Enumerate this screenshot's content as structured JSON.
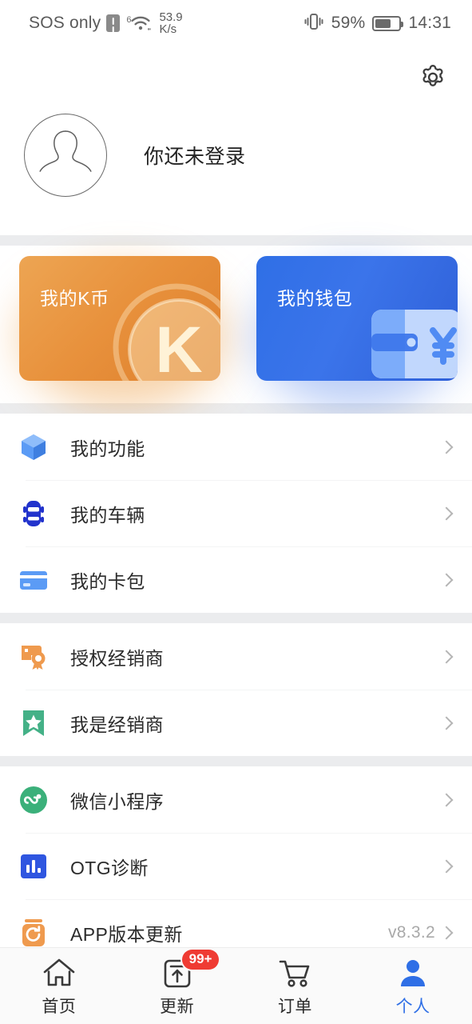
{
  "status_bar": {
    "carrier": "SOS only",
    "sim_icon": "sim-alert-icon",
    "wifi_icon": "wifi-icon",
    "wifi_generation": "6",
    "net_speed_value": "53.9",
    "net_speed_unit": "K/s",
    "vibrate_icon": "vibrate-icon",
    "battery_percent_label": "59%",
    "battery_level": 59,
    "battery_icon": "battery-icon",
    "clock": "14:31"
  },
  "header": {
    "settings_icon": "gear-icon",
    "avatar_icon": "avatar-placeholder-icon",
    "login_prompt": "你还未登录"
  },
  "cards": [
    {
      "id": "k-coin",
      "title": "我的K币",
      "art_icon": "coin-k-icon",
      "color_start": "#eda553",
      "color_end": "#dd7f2c"
    },
    {
      "id": "wallet",
      "title": "我的钱包",
      "art_icon": "wallet-yuan-icon",
      "color_start": "#2f6fe6",
      "color_end": "#2f60d8"
    }
  ],
  "menu_groups": [
    {
      "items": [
        {
          "label": "我的功能",
          "icon": "cube-3d-icon",
          "icon_color": "#5b9bf5",
          "value": ""
        },
        {
          "label": "我的车辆",
          "icon": "car-top-view-icon",
          "icon_color": "#2233cc",
          "value": ""
        },
        {
          "label": "我的卡包",
          "icon": "credit-card-icon",
          "icon_color": "#5b9bf5",
          "value": ""
        }
      ]
    },
    {
      "items": [
        {
          "label": "授权经销商",
          "icon": "certificate-award-icon",
          "icon_color": "#ef9a4e",
          "value": ""
        },
        {
          "label": "我是经销商",
          "icon": "bookmark-star-icon",
          "icon_color": "#44b187",
          "value": ""
        }
      ]
    },
    {
      "items": [
        {
          "label": "微信小程序",
          "icon": "wechat-miniprogram-icon",
          "icon_color": "#3bb07a",
          "value": ""
        },
        {
          "label": "OTG诊断",
          "icon": "bar-chart-icon",
          "icon_color": "#2f56e0",
          "value": ""
        },
        {
          "label": "APP版本更新",
          "icon": "app-update-icon",
          "icon_color": "#ef9a4e",
          "value": "v8.3.2"
        }
      ]
    }
  ],
  "tabbar": {
    "items": [
      {
        "label": "首页",
        "icon": "home-icon",
        "active": false,
        "badge": ""
      },
      {
        "label": "更新",
        "icon": "upload-box-icon",
        "active": false,
        "badge": "99+"
      },
      {
        "label": "订单",
        "icon": "shopping-cart-icon",
        "active": false,
        "badge": ""
      },
      {
        "label": "个人",
        "icon": "person-icon",
        "active": true,
        "badge": ""
      }
    ],
    "active_color": "#2f6fe6",
    "badge_color": "#ef3b33"
  }
}
